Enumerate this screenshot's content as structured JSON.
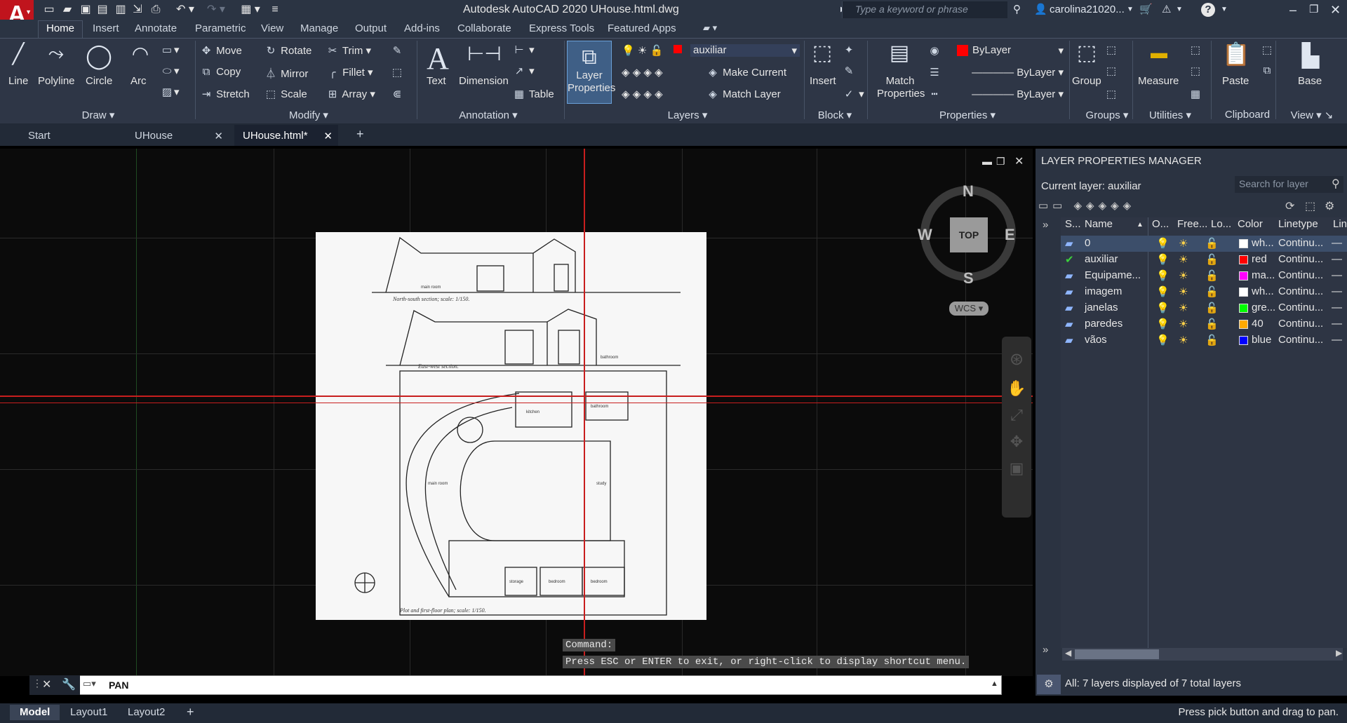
{
  "app": {
    "logo": "A",
    "title": "Autodesk AutoCAD 2020    UHouse.html.dwg",
    "search_placeholder": "Type a keyword or phrase",
    "user": "carolina21020...",
    "help": "?"
  },
  "ribbon_tabs": [
    "Home",
    "Insert",
    "Annotate",
    "Parametric",
    "View",
    "Manage",
    "Output",
    "Add-ins",
    "Collaborate",
    "Express Tools",
    "Featured Apps"
  ],
  "ribbon": {
    "draw": {
      "line": "Line",
      "polyline": "Polyline",
      "circle": "Circle",
      "arc": "Arc",
      "footer": "Draw"
    },
    "modify": {
      "move": "Move",
      "rotate": "Rotate",
      "trim": "Trim",
      "copy": "Copy",
      "mirror": "Mirror",
      "fillet": "Fillet",
      "stretch": "Stretch",
      "scale": "Scale",
      "array": "Array",
      "footer": "Modify"
    },
    "annotation": {
      "text": "Text",
      "dimension": "Dimension",
      "table": "Table",
      "footer": "Annotation"
    },
    "layers": {
      "layer_properties": "Layer Properties",
      "current_layer": "auxiliar",
      "make_current": "Make Current",
      "match_layer": "Match Layer",
      "footer": "Layers"
    },
    "block": {
      "insert": "Insert",
      "footer": "Block"
    },
    "properties": {
      "match_properties": "Match Properties",
      "color": "ByLayer",
      "linetype": "ByLayer",
      "lineweight": "ByLayer",
      "footer": "Properties"
    },
    "groups": {
      "group": "Group",
      "footer": "Groups"
    },
    "utilities": {
      "measure": "Measure",
      "footer": "Utilities"
    },
    "clipboard": {
      "paste": "Paste",
      "footer": "Clipboard"
    },
    "view": {
      "base": "Base",
      "footer": "View"
    }
  },
  "doc_tabs": [
    "Start",
    "UHouse",
    "UHouse.html*"
  ],
  "drawing_labels": {
    "section1": "North-south section; scale: 1/150.",
    "section2": "East-west section.",
    "plan": "Plot and first-floor plan; scale: 1/150.",
    "main_room": "main room",
    "kitchen": "kitchen",
    "bathroom": "bathroom",
    "study": "study",
    "storage": "storage",
    "bedroom": "bedroom"
  },
  "viewcube": {
    "north": "N",
    "south": "S",
    "east": "E",
    "west": "W",
    "top": "TOP",
    "wcs": "WCS"
  },
  "command": {
    "history_1": "Command:",
    "history_2": "Press ESC or ENTER to exit, or right-click to display shortcut menu.",
    "current": "PAN"
  },
  "layout_tabs": [
    "Model",
    "Layout1",
    "Layout2"
  ],
  "status_text": "Press pick button and drag to pan.",
  "layer_manager": {
    "title": "LAYER PROPERTIES MANAGER",
    "current_layer": "Current layer: auxiliar",
    "search_placeholder": "Search for layer",
    "headers": [
      "S...",
      "Name",
      "O...",
      "Free...",
      "Lo...",
      "Color",
      "Linetype",
      "Lin"
    ],
    "layers": [
      {
        "name": "0",
        "color_name": "wh...",
        "color": "#ffffff",
        "linetype": "Continu..."
      },
      {
        "name": "auxiliar",
        "color_name": "red",
        "color": "#ff0000",
        "linetype": "Continu..."
      },
      {
        "name": "Equipame...",
        "color_name": "ma...",
        "color": "#ff00ff",
        "linetype": "Continu..."
      },
      {
        "name": "imagem",
        "color_name": "wh...",
        "color": "#ffffff",
        "linetype": "Continu..."
      },
      {
        "name": "janelas",
        "color_name": "gre...",
        "color": "#00ff00",
        "linetype": "Continu..."
      },
      {
        "name": "paredes",
        "color_name": "40",
        "color": "#ffaa00",
        "linetype": "Continu..."
      },
      {
        "name": "vãos",
        "color_name": "blue",
        "color": "#0000ff",
        "linetype": "Continu..."
      }
    ],
    "footer": "All: 7 layers displayed of 7 total layers"
  }
}
